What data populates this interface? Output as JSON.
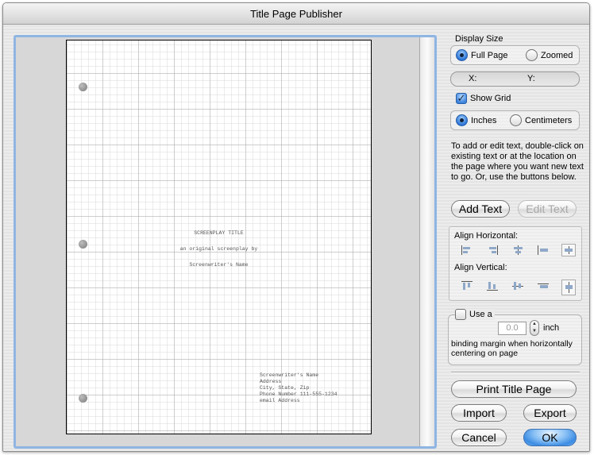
{
  "window": {
    "title": "Title Page Publisher"
  },
  "page": {
    "title_line": "SCREENPLAY TITLE",
    "subtitle_line": "an original screenplay by",
    "writer_line": "Screenwriter's Name",
    "contact": [
      "Screenwriter's Name",
      "Address",
      "City, State, Zip",
      "Phone Number 111-555-1234",
      "email Address"
    ]
  },
  "display_size": {
    "label": "Display Size",
    "full_page": "Full Page",
    "zoomed": "Zoomed",
    "selected": "Full Page"
  },
  "coords": {
    "x_label": "X:",
    "y_label": "Y:"
  },
  "show_grid": {
    "label": "Show Grid",
    "checked": true
  },
  "units": {
    "inches": "Inches",
    "centimeters": "Centimeters",
    "selected": "Inches"
  },
  "help_text": "To add or edit text, double-click on existing text or at the location on the page where you want new text to go.  Or, use the buttons below.",
  "buttons": {
    "add_text": "Add Text",
    "edit_text": "Edit Text",
    "print": "Print Title Page",
    "import": "Import",
    "export": "Export",
    "cancel": "Cancel",
    "ok": "OK"
  },
  "align": {
    "horizontal_label": "Align Horizontal:",
    "vertical_label": "Align Vertical:",
    "horizontal_icons": [
      "align-left-icon",
      "align-right-icon",
      "align-center-icon",
      "align-inside-left-icon",
      "align-center-selected-icon"
    ],
    "vertical_icons": [
      "align-top-icon",
      "align-bottom-icon",
      "align-middle-icon",
      "align-spread-icon",
      "align-vertical-center-selected-icon"
    ]
  },
  "binding_margin": {
    "checkbox_label": "Use a",
    "checked": false,
    "value": "0.0",
    "unit": "inch",
    "description": "binding margin when horizontally centering on page"
  },
  "colors": {
    "accent": "#3c8ce3",
    "focus_ring": "#8fb5e3"
  }
}
